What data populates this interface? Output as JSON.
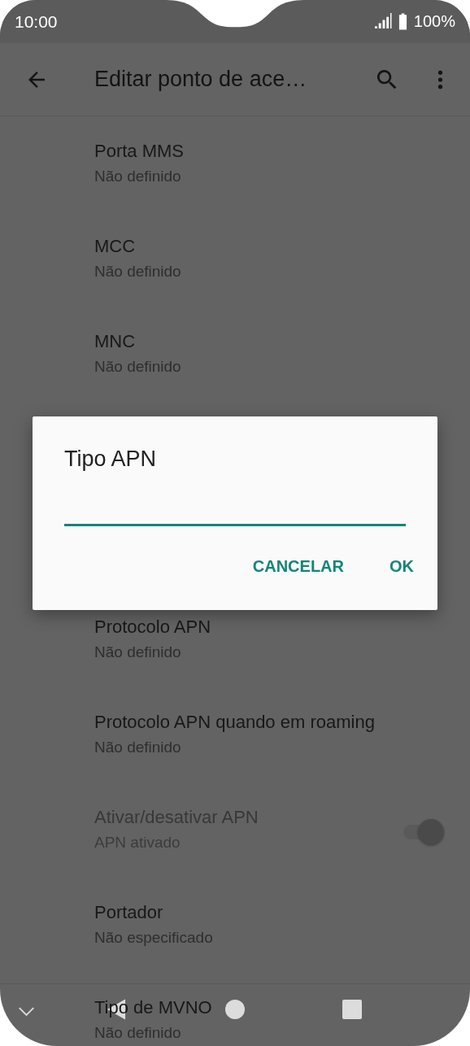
{
  "status_bar": {
    "time": "10:00",
    "battery": "100%"
  },
  "toolbar": {
    "title": "Editar ponto de ace…"
  },
  "settings_top": [
    {
      "title": "Porta MMS",
      "summary": "Não definido",
      "kind": "text",
      "disabled": false
    },
    {
      "title": "MCC",
      "summary": "Não definido",
      "kind": "text",
      "disabled": false
    },
    {
      "title": "MNC",
      "summary": "Não definido",
      "kind": "text",
      "disabled": false
    }
  ],
  "settings_bottom": [
    {
      "title": "Protocolo APN",
      "summary": "Não definido",
      "kind": "text",
      "disabled": false
    },
    {
      "title": "Protocolo APN quando em roaming",
      "summary": "Não definido",
      "kind": "text",
      "disabled": false
    },
    {
      "title": "Ativar/desativar APN",
      "summary": "APN ativado",
      "kind": "toggle",
      "disabled": true,
      "on": true
    },
    {
      "title": "Portador",
      "summary": "Não especificado",
      "kind": "text",
      "disabled": false
    },
    {
      "title": "Tipo de MVNO",
      "summary": "Não definido",
      "kind": "text",
      "disabled": false
    }
  ],
  "dialog": {
    "title": "Tipo APN",
    "buttons": [
      "CANCELAR",
      "OK"
    ]
  }
}
